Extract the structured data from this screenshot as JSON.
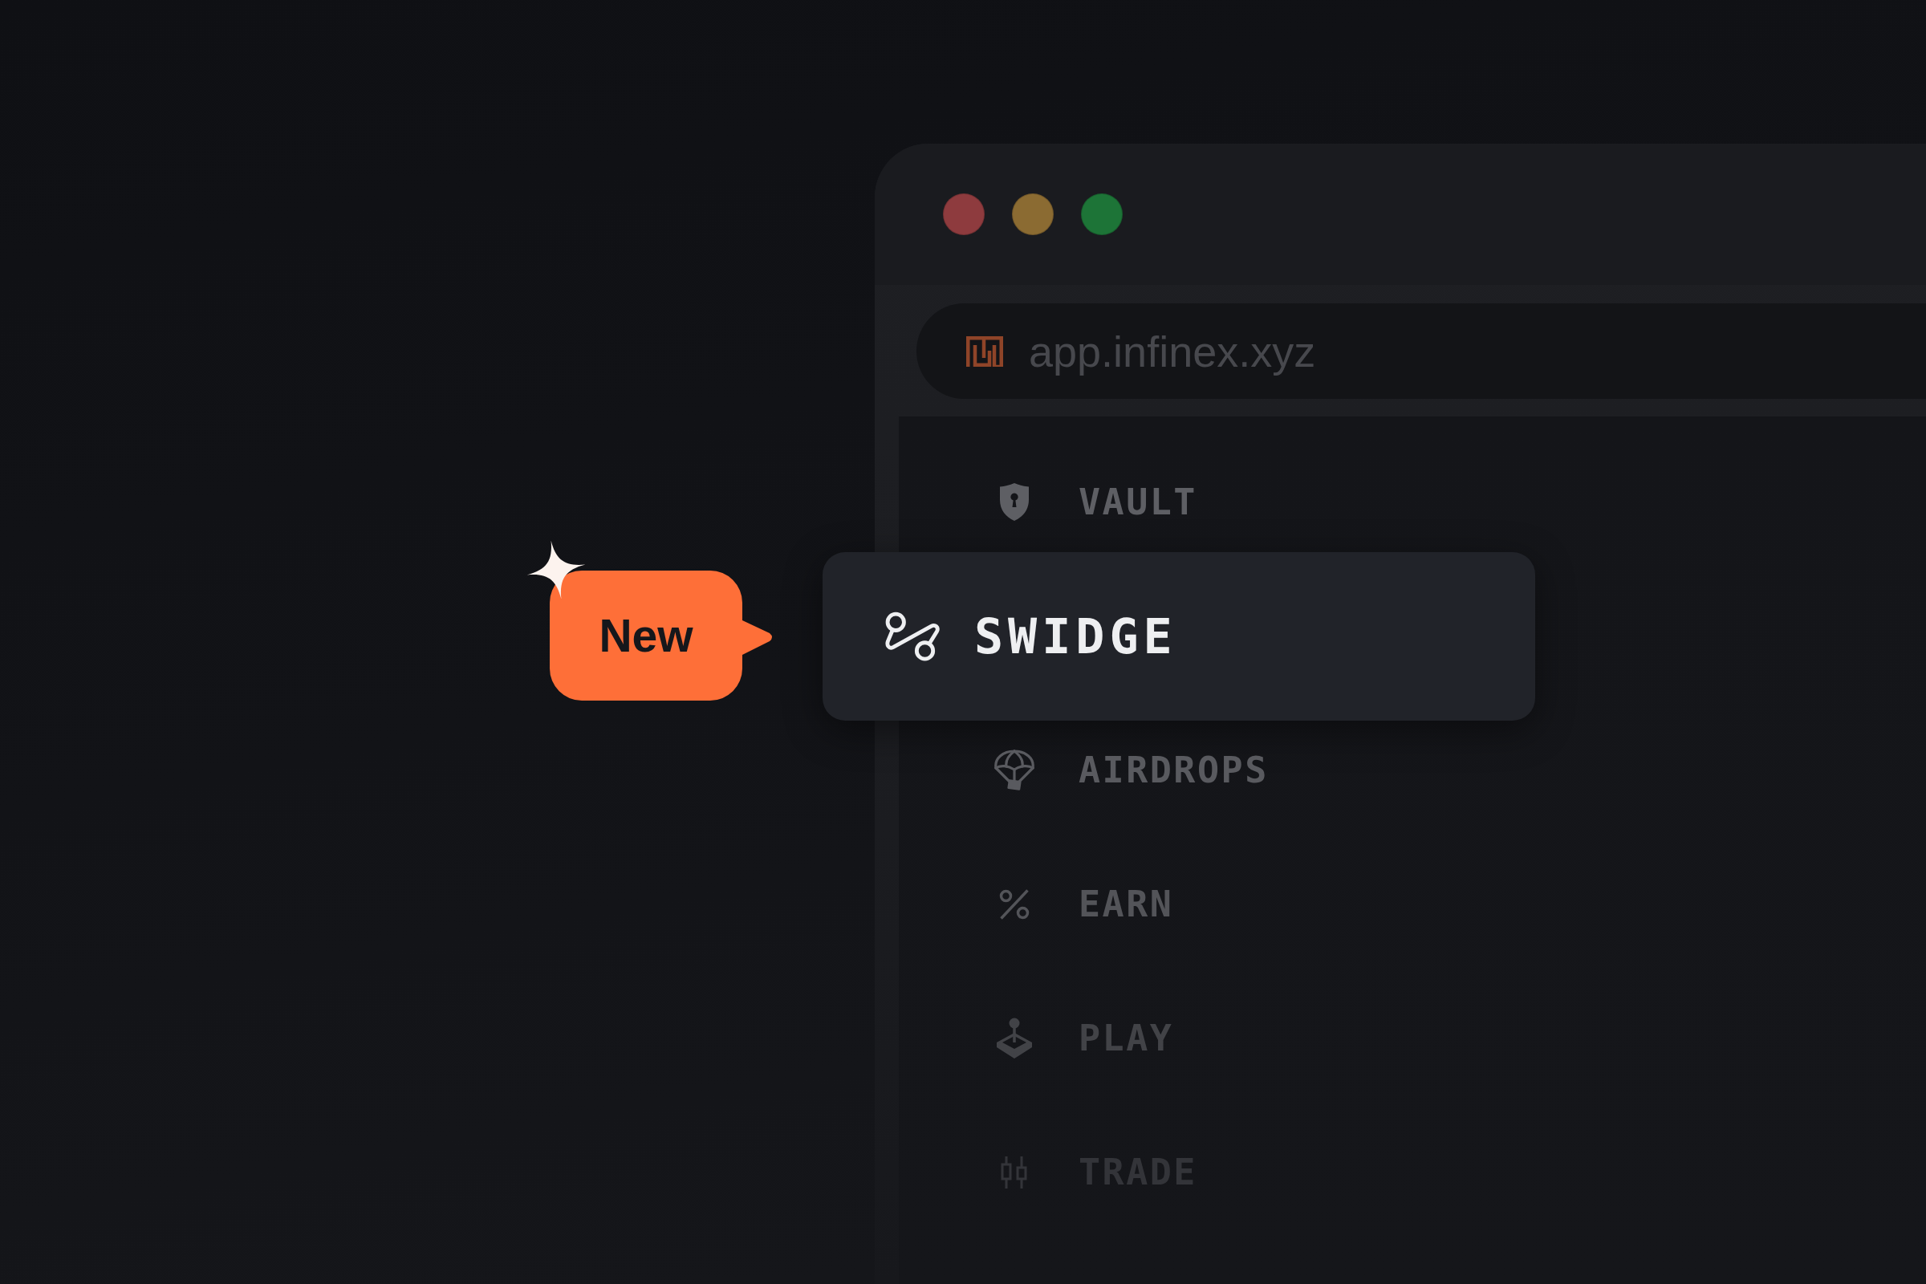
{
  "browser": {
    "address_bar": {
      "url": "app.infinex.xyz"
    }
  },
  "nav": {
    "items": [
      {
        "label": "VAULT",
        "selected": false
      },
      {
        "label": "SWIDGE",
        "selected": true,
        "badge": "New"
      },
      {
        "label": "AIRDROPS",
        "selected": false
      },
      {
        "label": "EARN",
        "selected": false
      },
      {
        "label": "PLAY",
        "selected": false
      },
      {
        "label": "TRADE",
        "selected": false
      }
    ]
  }
}
